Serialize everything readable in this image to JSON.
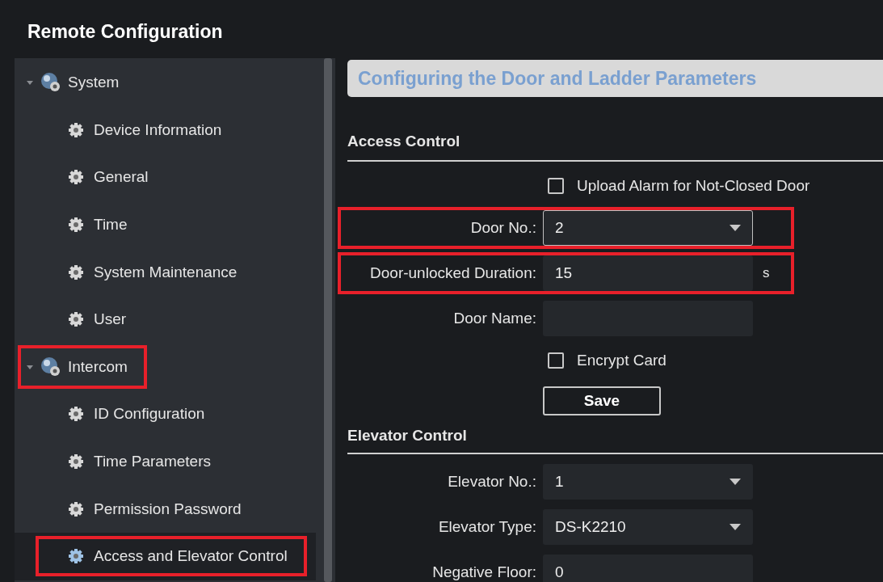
{
  "window": {
    "title": "Remote Configuration"
  },
  "sidebar": {
    "groups": [
      {
        "label": "System",
        "expanded": true,
        "highlighted": false,
        "children": [
          {
            "label": "Device Information",
            "selected": false,
            "highlighted": false
          },
          {
            "label": "General",
            "selected": false,
            "highlighted": false
          },
          {
            "label": "Time",
            "selected": false,
            "highlighted": false
          },
          {
            "label": "System Maintenance",
            "selected": false,
            "highlighted": false
          },
          {
            "label": "User",
            "selected": false,
            "highlighted": false
          }
        ]
      },
      {
        "label": "Intercom",
        "expanded": true,
        "highlighted": true,
        "children": [
          {
            "label": "ID Configuration",
            "selected": false,
            "highlighted": false
          },
          {
            "label": "Time Parameters",
            "selected": false,
            "highlighted": false
          },
          {
            "label": "Permission Password",
            "selected": false,
            "highlighted": false
          },
          {
            "label": "Access and Elevator Control",
            "selected": true,
            "highlighted": true
          }
        ]
      }
    ]
  },
  "content": {
    "title": "Configuring the Door and Ladder Parameters",
    "sections": [
      {
        "heading": "Access Control",
        "rows": [
          {
            "kind": "checkbox",
            "label": "Upload Alarm for Not-Closed Door",
            "checked": false,
            "highlighted": false
          },
          {
            "kind": "select",
            "label": "Door No.:",
            "value": "2",
            "highlighted": true
          },
          {
            "kind": "input",
            "label": "Door-unlocked Duration:",
            "value": "15",
            "unit": "s",
            "highlighted": true
          },
          {
            "kind": "input",
            "label": "Door Name:",
            "highlighted": false
          },
          {
            "kind": "checkbox",
            "label": "Encrypt Card",
            "checked": false,
            "highlighted": false
          },
          {
            "kind": "button",
            "label": "Save",
            "highlighted": false
          }
        ]
      },
      {
        "heading": "Elevator Control",
        "rows": [
          {
            "kind": "select",
            "label": "Elevator No.:",
            "value": "1",
            "highlighted": false
          },
          {
            "kind": "select",
            "label": "Elevator Type:",
            "value": "DS-K2210",
            "highlighted": false
          },
          {
            "kind": "input",
            "label": "Negative Floor:",
            "value": "0",
            "highlighted": false
          }
        ]
      }
    ]
  }
}
